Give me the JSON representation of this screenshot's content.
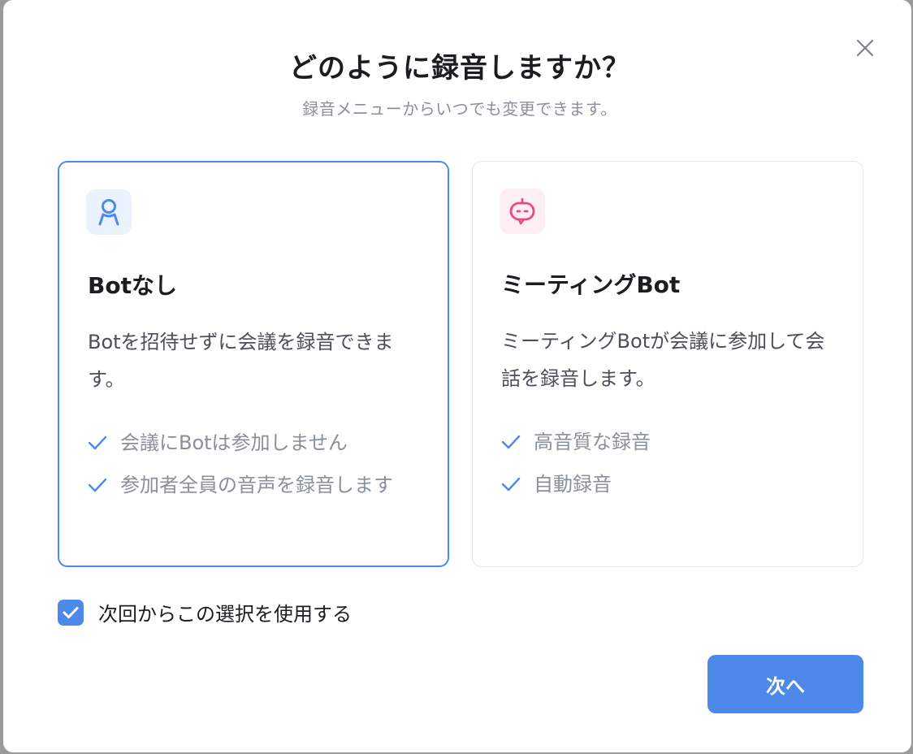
{
  "dialog": {
    "title": "どのように録音しますか？",
    "subtitle": "録音メニューからいつでも変更できます。",
    "close_icon": "close-icon"
  },
  "options": [
    {
      "title": "Botなし",
      "description": "Botを招待せずに会議を録音できます。",
      "icon": "person-icon",
      "selected": true,
      "features": [
        "会議にBotは参加しません",
        "参加者全員の音声を録音します"
      ]
    },
    {
      "title": "ミーティングBot",
      "description": "ミーティングBotが会議に参加して会話を録音します。",
      "icon": "robot-icon",
      "selected": false,
      "features": [
        "高音質な録音",
        "自動録音"
      ]
    }
  ],
  "remember": {
    "label": "次回からこの選択を使用する",
    "checked": true
  },
  "next_button": {
    "label": "次へ"
  },
  "colors": {
    "accent": "#4d89e8",
    "robot_pink": "#e94b7e",
    "muted_text": "#8a9099"
  }
}
